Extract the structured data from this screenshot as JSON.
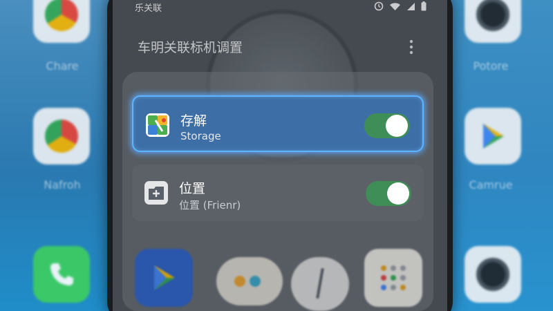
{
  "status_bar": {
    "carrier": "乐关联",
    "icons": [
      "alarm-icon",
      "wifi-icon",
      "signal-icon",
      "battery-icon"
    ]
  },
  "app_header": {
    "title": "车明关联标机调置",
    "more_icon": "more-vertical-icon"
  },
  "permissions": [
    {
      "title": "存解",
      "subtitle": "Storage",
      "icon": "photos-app-icon",
      "enabled": true,
      "highlighted": true
    },
    {
      "title": "位置",
      "subtitle": "位置 (Frienr)",
      "icon": "folder-plus-icon",
      "enabled": true,
      "highlighted": false
    }
  ],
  "background_labels": {
    "left_1": "Chare",
    "left_2": "Nafroh",
    "right_1": "Potore",
    "right_2": "Camrue"
  },
  "colors": {
    "highlight_border": "#5fb3ff",
    "toggle_on": "#3f8e57",
    "card_highlight_bg": "#3d6fa6"
  }
}
